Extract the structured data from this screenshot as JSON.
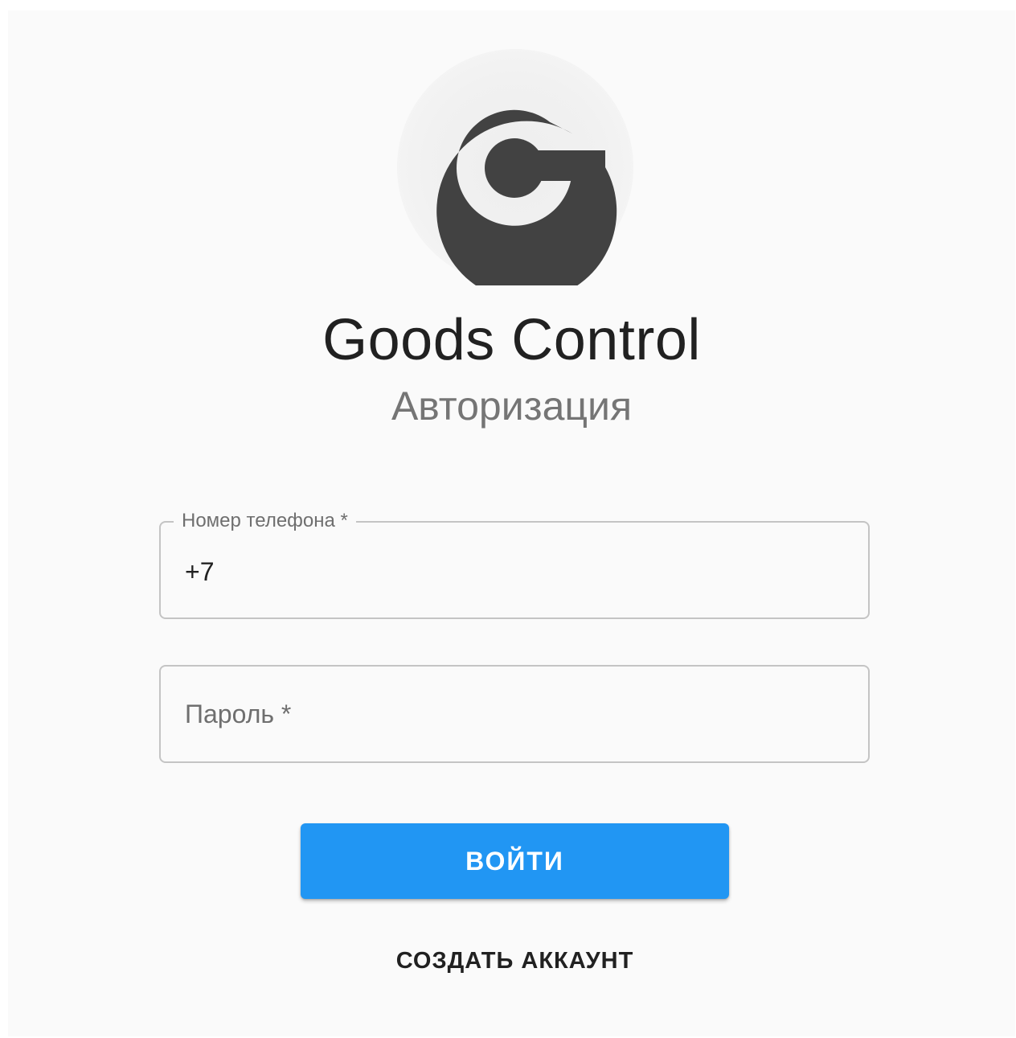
{
  "app": {
    "title": "Goods Control",
    "subtitle": "Авторизация"
  },
  "logo": {
    "icon": "goods-control-g-logo",
    "color": "#424242",
    "background": "#eeeeee"
  },
  "form": {
    "phone": {
      "label": "Номер телефона *",
      "value": "+7"
    },
    "password": {
      "placeholder": "Пароль *",
      "value": ""
    },
    "login_label": "ВОЙТИ",
    "create_account_label": "СОЗДАТЬ АККАУНТ"
  },
  "colors": {
    "primary": "#2196f3",
    "text": "#212121",
    "secondary_text": "#757575",
    "border": "#c4c4c4",
    "page_background": "#fafafa"
  }
}
